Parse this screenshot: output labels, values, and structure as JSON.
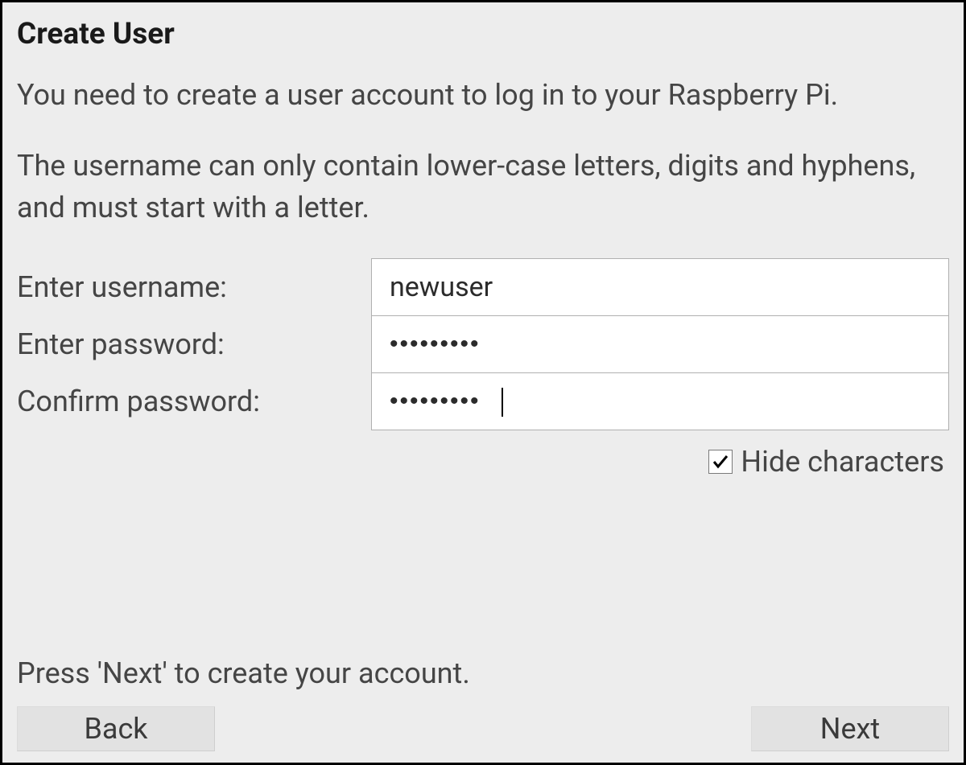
{
  "dialog": {
    "title": "Create User",
    "description": "You need to create a user account to log in to your Raspberry Pi.",
    "rules": "The username can only contain lower-case letters, digits and hyphens, and must start with a letter.",
    "instruction": "Press 'Next' to create your account."
  },
  "form": {
    "username_label": "Enter username:",
    "username_value": "newuser",
    "password_label": "Enter password:",
    "password_value": "•••••••••",
    "confirm_label": "Confirm password:",
    "confirm_value": "•••••••••",
    "hide_label": "Hide characters",
    "hide_checked": true
  },
  "buttons": {
    "back": "Back",
    "next": "Next"
  }
}
